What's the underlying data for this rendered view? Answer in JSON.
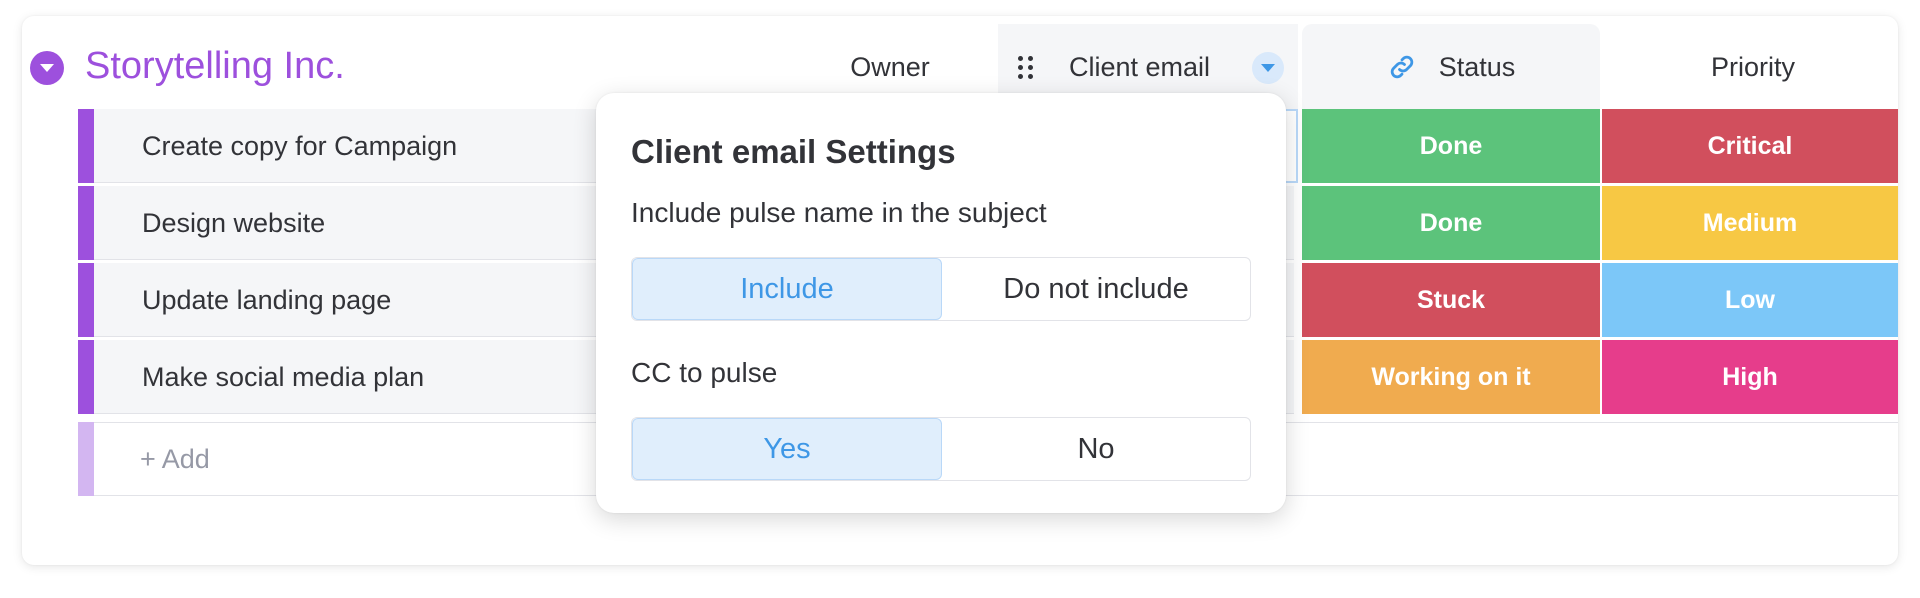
{
  "group": {
    "title": "Storytelling Inc.",
    "accent": "#9d50dd"
  },
  "columns": {
    "owner": "Owner",
    "client_email": "Client email",
    "status": "Status",
    "priority": "Priority"
  },
  "rows": [
    {
      "name": "Create copy for Campaign",
      "status": "Done",
      "status_color": "#5cc37b",
      "priority": "Critical",
      "priority_color": "#d14f5d"
    },
    {
      "name": "Design website",
      "status": "Done",
      "status_color": "#5cc37b",
      "priority": "Medium",
      "priority_color": "#f7c844"
    },
    {
      "name": "Update landing page",
      "status": "Stuck",
      "status_color": "#d14f5d",
      "priority": "Low",
      "priority_color": "#7cc7f8"
    },
    {
      "name": "Make social media plan",
      "status": "Working on it",
      "status_color": "#f0ab4f",
      "priority": "High",
      "priority_color": "#e63d8b"
    }
  ],
  "add_row": {
    "label": "+ Add"
  },
  "popover": {
    "title": "Client email Settings",
    "subject_label": "Include pulse name in the subject",
    "subject_options": [
      "Include",
      "Do not include"
    ],
    "subject_selected": "Include",
    "cc_label": "CC to pulse",
    "cc_options": [
      "Yes",
      "No"
    ],
    "cc_selected": "Yes"
  },
  "icons": {
    "group_toggle": "chevron-down-circle-icon",
    "drag": "drag-handle-icon",
    "column_menu": "caret-down-icon",
    "status_link": "link-icon"
  }
}
